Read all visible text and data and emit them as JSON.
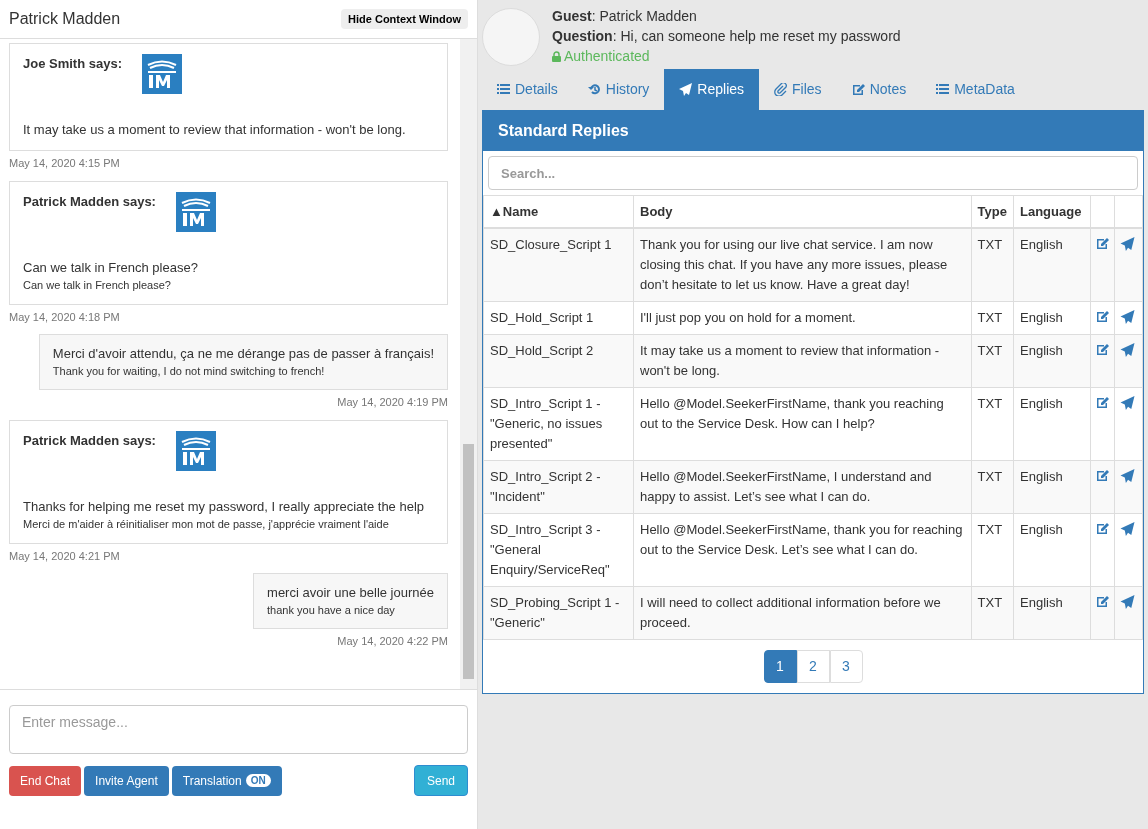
{
  "chat": {
    "title": "Patrick Madden",
    "hide_button": "Hide Context Window",
    "messages": [
      {
        "kind": "incoming",
        "author": "Joe Smith says:",
        "text": "It may take us a moment to review that information - won't be long.",
        "time": "May 14, 2020 4:15 PM"
      },
      {
        "kind": "incoming",
        "author": "Patrick Madden says:",
        "text": "Can we talk in French please?",
        "translation": "Can we talk in French please?",
        "time": "May 14, 2020 4:18 PM"
      },
      {
        "kind": "outgoing",
        "text": "Merci d'avoir attendu, ça ne me dérange pas de passer à français!",
        "translation": "Thank you for waiting, I do not mind switching to french!",
        "time": "May 14, 2020 4:19 PM"
      },
      {
        "kind": "incoming",
        "author": "Patrick Madden says:",
        "text": "Thanks for helping me reset my password, I really appreciate the help",
        "translation": "Merci de m'aider à réinitialiser mon mot de passe, j'apprécie vraiment l'aide",
        "time": "May 14, 2020 4:21 PM"
      },
      {
        "kind": "outgoing",
        "text": "merci avoir une belle journée",
        "translation": "thank you have a nice day",
        "time": "May 14, 2020 4:22 PM"
      }
    ],
    "input": {
      "placeholder": "Enter message..."
    },
    "buttons": {
      "end": "End Chat",
      "invite": "Invite Agent",
      "translation": "Translation",
      "translation_badge": "ON",
      "send": "Send"
    }
  },
  "context": {
    "guest": "**Guest**: Patrick Madden",
    "question": "**Question**: Hi, can someone help me reset my password",
    "status": "Authenticated",
    "tabs": [
      {
        "kind": "list",
        "label": "Details",
        "selected": false
      },
      {
        "kind": "history",
        "label": "History",
        "selected": false
      },
      {
        "kind": "send",
        "label": "Replies",
        "selected": true
      },
      {
        "kind": "clip",
        "label": "Files",
        "selected": false
      },
      {
        "kind": "edit",
        "label": "Notes",
        "selected": false
      },
      {
        "kind": "list",
        "label": "MetaData",
        "selected": false
      }
    ],
    "panel_title": "Standard Replies",
    "search": {
      "placeholder": "Search..."
    },
    "table": {
      "columns": [
        "▲Name",
        "Body",
        "Type",
        "Language"
      ],
      "rows": [
        {
          "name": "SD_Closure_Script 1",
          "body": "Thank you for using our live chat service. I am now closing this chat. If you have any more issues, please don’t hesitate to let us know. Have a great day!",
          "type": "TXT",
          "language": "English"
        },
        {
          "name": "SD_Hold_Script 1",
          "body": "I'll just pop you on hold for a moment.",
          "type": "TXT",
          "language": "English"
        },
        {
          "name": "SD_Hold_Script 2",
          "body": "It may take us a moment to review that information - won't be long.",
          "type": "TXT",
          "language": "English"
        },
        {
          "name": "SD_Intro_Script 1 - \"Generic, no issues presented\"",
          "body": "Hello @Model.SeekerFirstName, thank you reaching out to the Service Desk. How can I help?",
          "type": "TXT",
          "language": "English"
        },
        {
          "name": "SD_Intro_Script 2 - \"Incident\"",
          "body": "Hello @Model.SeekerFirstName, I understand and happy to assist. Let’s see what I can do.",
          "type": "TXT",
          "language": "English"
        },
        {
          "name": "SD_Intro_Script 3 - \"General Enquiry/ServiceReq\"",
          "body": "Hello @Model.SeekerFirstName, thank you for reaching out to the Service Desk. Let’s see what I can do.",
          "type": "TXT",
          "language": "English"
        },
        {
          "name": "SD_Probing_Script 1 - \"Generic\"",
          "body": "I will need to collect additional information before we proceed.",
          "type": "TXT",
          "language": "English"
        }
      ]
    },
    "pages": [
      {
        "label": "1",
        "selected": true
      },
      {
        "label": "2",
        "selected": false
      },
      {
        "label": "3",
        "selected": false
      }
    ]
  }
}
